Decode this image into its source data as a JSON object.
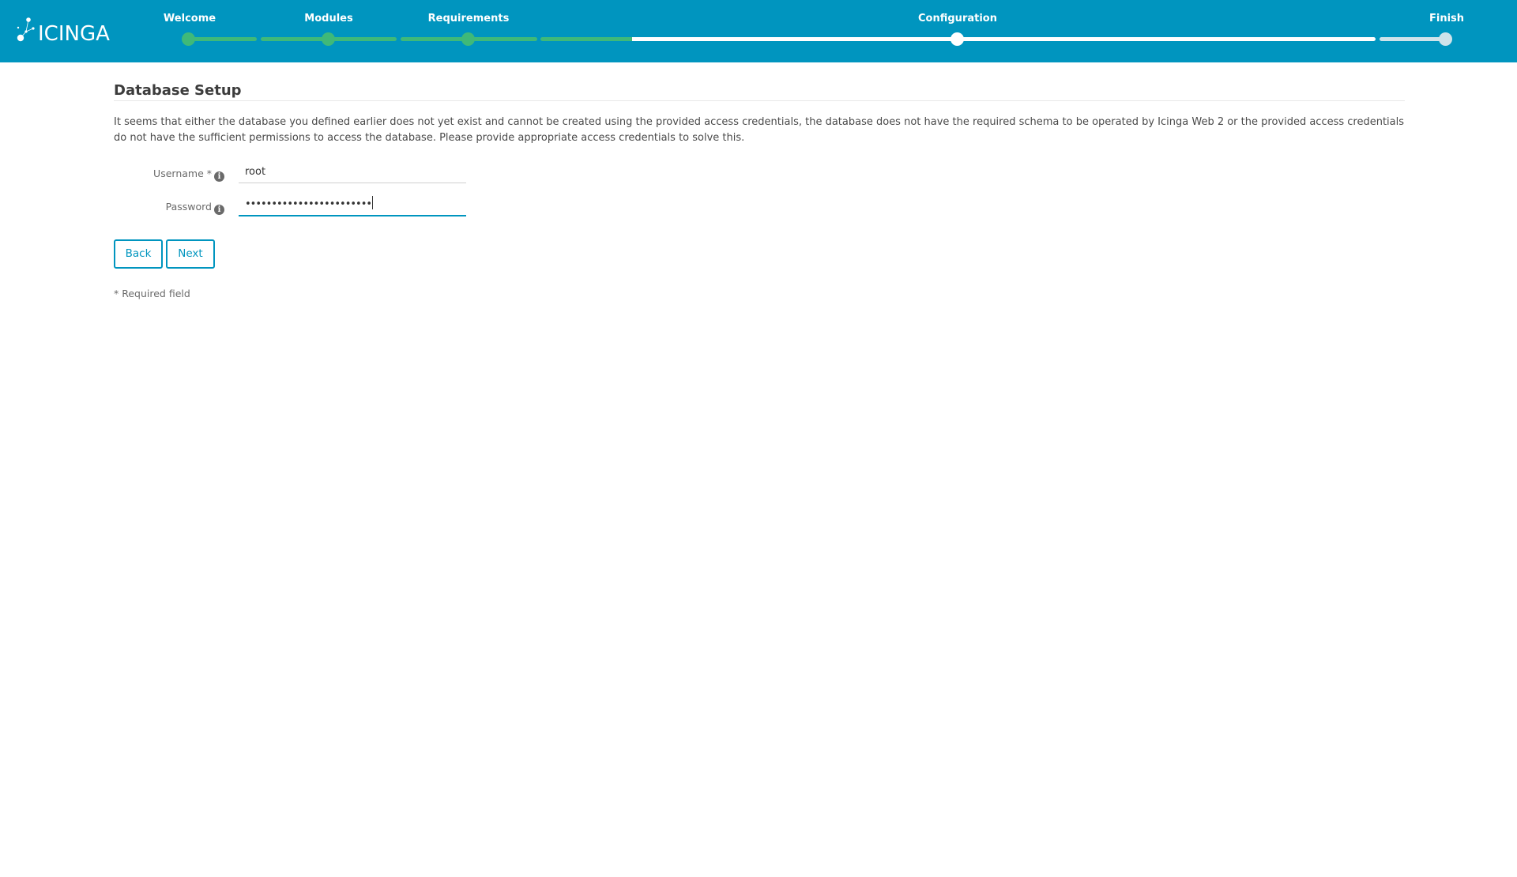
{
  "app": {
    "logo_text": "ICINGA"
  },
  "wizard": {
    "steps": [
      {
        "label": "Welcome",
        "state": "done"
      },
      {
        "label": "Modules",
        "state": "done"
      },
      {
        "label": "Requirements",
        "state": "done"
      },
      {
        "label": "Configuration",
        "state": "current"
      },
      {
        "label": "Finish",
        "state": "pending"
      }
    ],
    "colors": {
      "header_bg": "#0095bf",
      "done": "#3fb979",
      "current": "#ffffff",
      "pending": "#cfe3ea"
    }
  },
  "page": {
    "title": "Database Setup",
    "description": "It seems that either the database you defined earlier does not yet exist and cannot be created using the provided access credentials, the database does not have the required schema to be operated by Icinga Web 2 or the provided access credentials do not have the sufficient permissions to access the database. Please provide appropriate access credentials to solve this."
  },
  "form": {
    "username": {
      "label": "Username *",
      "value": "root",
      "info_icon": "info-icon"
    },
    "password": {
      "label": "Password",
      "value": "••••••••••••••••••••••••",
      "info_icon": "info-icon"
    }
  },
  "buttons": {
    "back": "Back",
    "next": "Next"
  },
  "required_note": "* Required field",
  "accent_color": "#0095bf"
}
